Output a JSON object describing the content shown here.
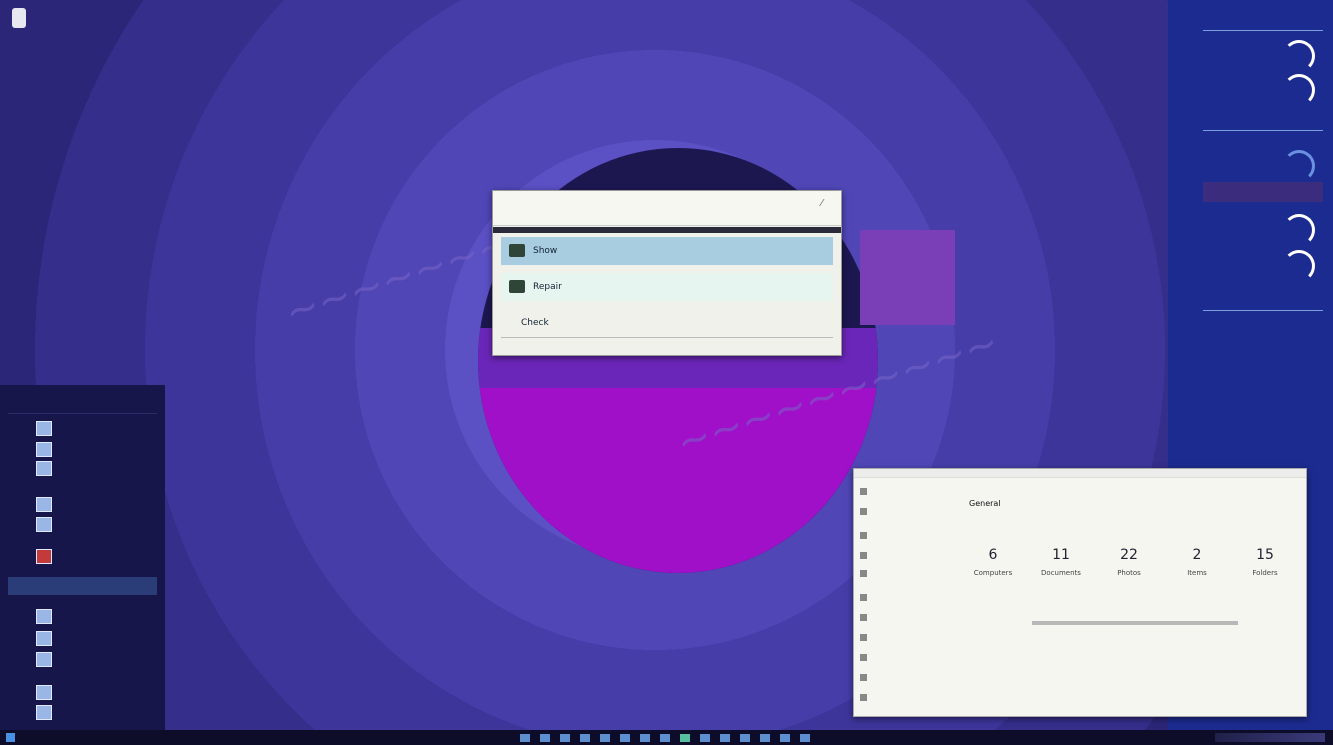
{
  "dialog": {
    "options": [
      {
        "label": "Show"
      },
      {
        "label": "Repair"
      },
      {
        "label": "Check"
      }
    ]
  },
  "properties": {
    "title": "General",
    "counts": [
      {
        "value": "6",
        "label": "Computers"
      },
      {
        "value": "11",
        "label": "Documents"
      },
      {
        "value": "22",
        "label": "Photos"
      },
      {
        "value": "2",
        "label": "Items"
      },
      {
        "value": "15",
        "label": "Folders"
      }
    ]
  },
  "colors": {
    "accent": "#6fe0c8",
    "highlight": "#cfe0ea"
  }
}
